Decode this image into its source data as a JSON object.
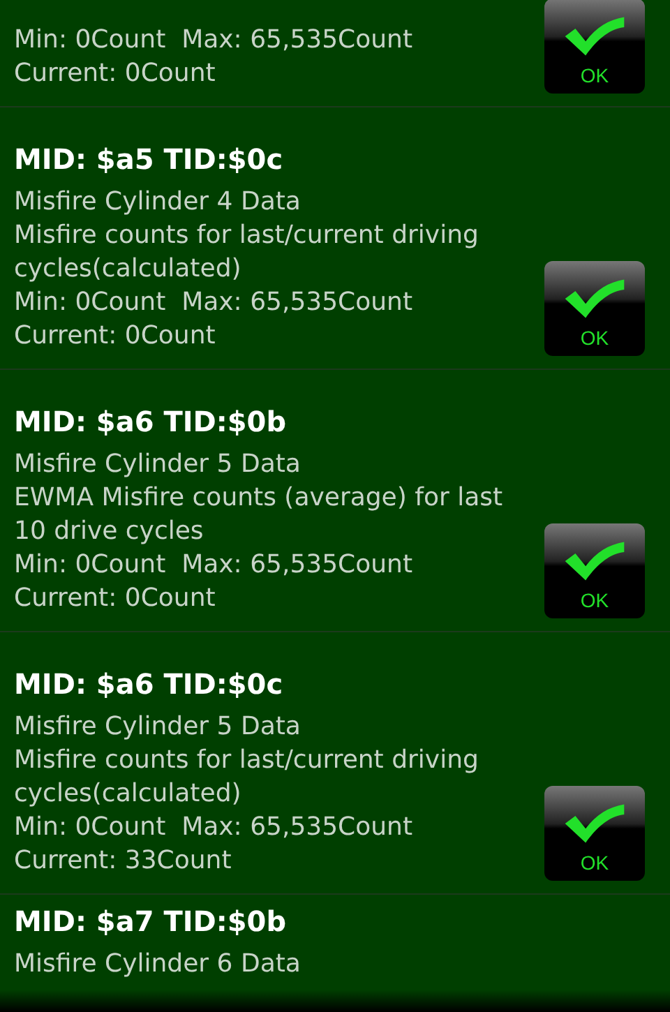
{
  "tests": [
    {
      "lines": [
        "Min: 0Count  Max: 65,535Count",
        "Current: 0Count"
      ],
      "status": {
        "kind": "ok",
        "label": "OK"
      }
    },
    {
      "title": "MID: $a5 TID:$0c",
      "lines": [
        "Misfire Cylinder 4 Data",
        "Misfire counts for last/current driving cycles(calculated)",
        "Min: 0Count  Max: 65,535Count",
        "Current: 0Count"
      ],
      "status": {
        "kind": "ok",
        "label": "OK"
      }
    },
    {
      "title": "MID: $a6 TID:$0b",
      "lines": [
        "Misfire Cylinder 5 Data",
        "EWMA Misfire counts (average) for last 10 drive cycles",
        "Min: 0Count  Max: 65,535Count",
        "Current: 0Count"
      ],
      "status": {
        "kind": "ok",
        "label": "OK"
      }
    },
    {
      "title": "MID: $a6 TID:$0c",
      "lines": [
        "Misfire Cylinder 5 Data",
        "Misfire counts for last/current driving cycles(calculated)",
        "Min: 0Count  Max: 65,535Count",
        "Current: 33Count"
      ],
      "status": {
        "kind": "ok",
        "label": "OK"
      }
    },
    {
      "title": "MID: $a7 TID:$0b",
      "lines": [
        "Misfire Cylinder 6 Data"
      ]
    }
  ]
}
